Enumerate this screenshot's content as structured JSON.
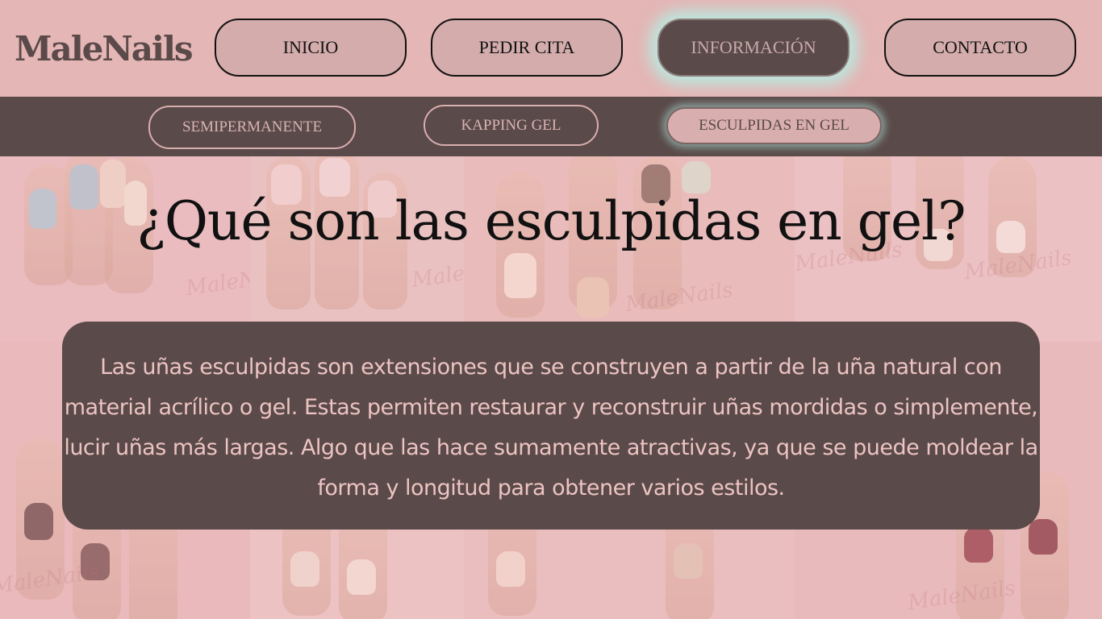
{
  "brand": {
    "logo": "MaleNails"
  },
  "nav": {
    "items": [
      {
        "label": "INICIO",
        "active": false
      },
      {
        "label": "PEDIR CITA",
        "active": false
      },
      {
        "label": "INFORMACIÓN",
        "active": true
      },
      {
        "label": "CONTACTO",
        "active": false
      }
    ]
  },
  "subnav": {
    "items": [
      {
        "label": "SEMIPERMANENTE",
        "active": false
      },
      {
        "label": "KAPPING GEL",
        "active": false
      },
      {
        "label": "ESCULPIDAS EN GEL",
        "active": true
      }
    ]
  },
  "main": {
    "title": "¿Qué son las esculpidas en gel?",
    "description": "Las uñas esculpidas son extensiones que se construyen a partir de la uña natural con material acrílico o gel. Estas permiten restaurar y reconstruir uñas mordidas o simplemente, lucir uñas más largas. Algo que las hace sumamente atractivas, ya que se puede moldear la forma y longitud para obtener varios estilos."
  },
  "background": {
    "watermark": "MaleNails"
  },
  "colors": {
    "header_bg": "#e4b6b5",
    "dark": "#5a4a49",
    "pink_button": "#d4acac",
    "glow": "#b4f0e6",
    "card_text": "#ecc4c2"
  }
}
